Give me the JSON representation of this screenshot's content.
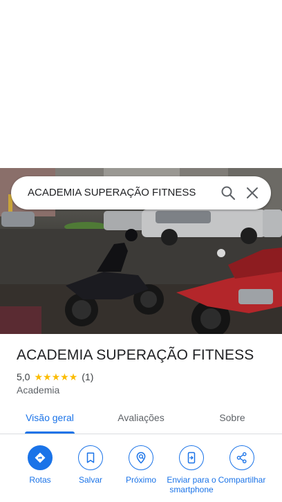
{
  "search": {
    "query": "ACADEMIA SUPERAÇÃO FITNESS",
    "search_icon": "search-icon",
    "close_icon": "close-icon"
  },
  "hero": {
    "photo": "street-with-motorcycles-and-parked-cars"
  },
  "place": {
    "title": "ACADEMIA SUPERAÇÃO FITNESS",
    "rating": "5,0",
    "stars": 5,
    "reviews": "(1)",
    "category": "Academia"
  },
  "tabs": [
    {
      "label": "Visão geral",
      "active": true
    },
    {
      "label": "Avaliações",
      "active": false
    },
    {
      "label": "Sobre",
      "active": false
    }
  ],
  "actions": [
    {
      "label": "Rotas",
      "icon": "directions-icon"
    },
    {
      "label": "Salvar",
      "icon": "bookmark-icon"
    },
    {
      "label": "Próximo",
      "icon": "nearby-icon"
    },
    {
      "label": "Enviar para o smartphone",
      "icon": "send-to-phone-icon"
    },
    {
      "label": "Compartilhar",
      "icon": "share-icon"
    }
  ],
  "colors": {
    "accent": "#1a73e8",
    "star": "#fbbc04",
    "text": "#202124"
  }
}
